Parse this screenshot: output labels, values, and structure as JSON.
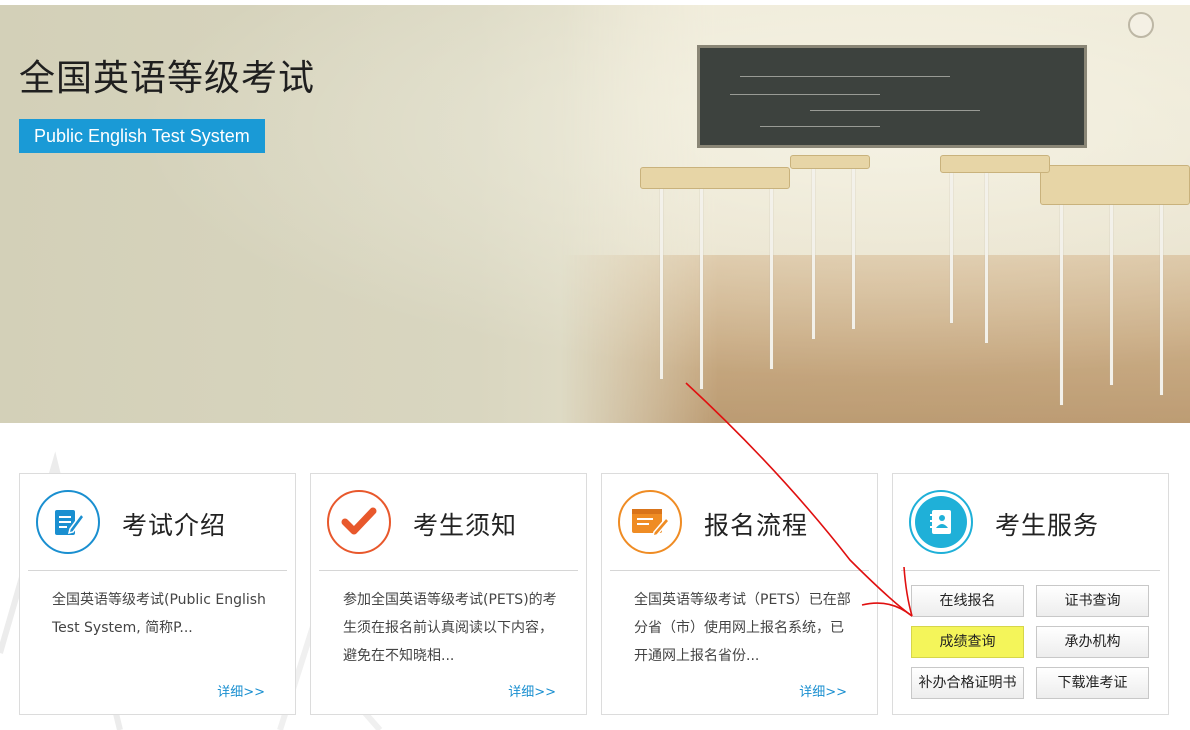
{
  "banner": {
    "title": "全国英语等级考试",
    "subtitle": "Public English Test System"
  },
  "cards": [
    {
      "title": "考试介绍",
      "icon": "document-pen-icon",
      "color": "#1a8fd0",
      "desc": "全国英语等级考试(Public English Test System, 简称P...",
      "more": "详细>>"
    },
    {
      "title": "考生须知",
      "icon": "checkmark-icon",
      "color": "#e8582c",
      "desc": "参加全国英语等级考试(PETS)的考生须在报名前认真阅读以下内容，避免在不知晓相...",
      "more": "详细>>"
    },
    {
      "title": "报名流程",
      "icon": "form-edit-icon",
      "color": "#ef8c24",
      "desc": "全国英语等级考试（PETS）已在部分省（市）使用网上报名系统，已开通网上报名省份...",
      "more": "详细>>"
    },
    {
      "title": "考生服务",
      "icon": "contact-book-icon",
      "color": "#1fb0d8",
      "buttons": [
        "在线报名",
        "证书查询",
        "成绩查询",
        "承办机构",
        "补办合格证明书",
        "下载准考证"
      ]
    }
  ],
  "colors": {
    "accent_blue": "#1a9ad6",
    "link_blue": "#1a8fd0",
    "highlight_yellow": "#f4f55a",
    "annotation_red": "#e01010"
  }
}
